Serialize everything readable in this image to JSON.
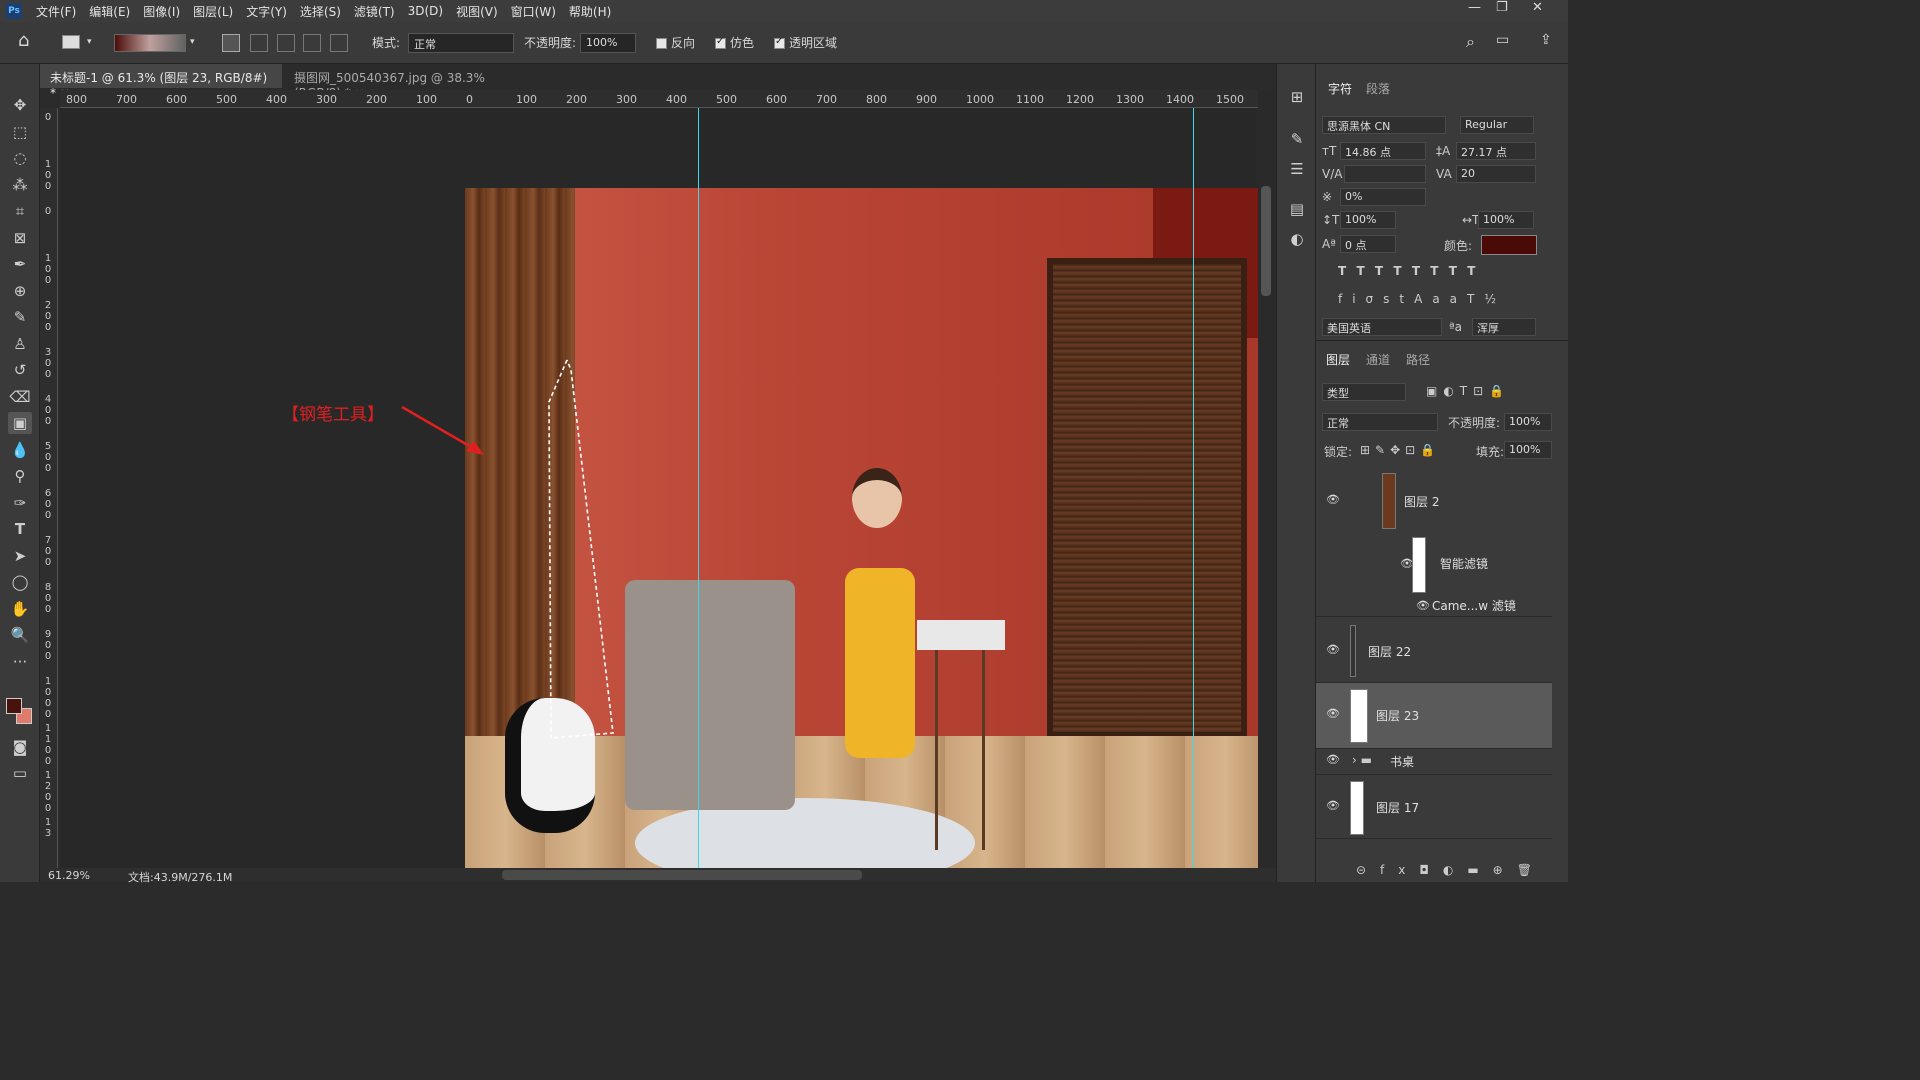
{
  "app": {
    "logo": "Ps"
  },
  "menu": [
    "文件(F)",
    "编辑(E)",
    "图像(I)",
    "图层(L)",
    "文字(Y)",
    "选择(S)",
    "滤镜(T)",
    "3D(D)",
    "视图(V)",
    "窗口(W)",
    "帮助(H)"
  ],
  "options": {
    "mode_label": "模式:",
    "mode_value": "正常",
    "opacity_label": "不透明度:",
    "opacity_value": "100%",
    "reverse_label": "反向",
    "dither_label": "仿色",
    "transparency_label": "透明区域"
  },
  "tabs": [
    {
      "label": "未标题-1 @ 61.3% (图层 23, RGB/8#) *",
      "close": "×"
    },
    {
      "label": "摄图网_500540367.jpg @ 38.3%(RGB/8) *",
      "close": "×"
    }
  ],
  "ruler_h": [
    "800",
    "700",
    "600",
    "500",
    "400",
    "300",
    "200",
    "100",
    "0",
    "100",
    "200",
    "300",
    "400",
    "500",
    "600",
    "700",
    "800",
    "900",
    "1000",
    "1100",
    "1200",
    "1300",
    "1400",
    "1500"
  ],
  "ruler_v": [
    "0",
    "1 0 0",
    "0",
    "1 0 0",
    "2 0 0",
    "3 0 0",
    "4 0 0",
    "5 0 0",
    "6 0 0",
    "7 0 0",
    "8 0 0",
    "9 0 0",
    "1 0 0 0",
    "1 1 0 0",
    "1 2 0 0",
    "1 3"
  ],
  "annotation": "【钢笔工具】",
  "status": {
    "zoom": "61.29%",
    "doc": "文档:43.9M/276.1M"
  },
  "character": {
    "tab1": "字符",
    "tab2": "段落",
    "font": "思源黑体 CN",
    "style": "Regular",
    "size": "14.86 点",
    "leading": "27.17 点",
    "kerning": "",
    "tracking": "20",
    "scale_pct": "0%",
    "vscale": "100%",
    "hscale": "100%",
    "baseline": "0 点",
    "color_label": "颜色:",
    "color": "#4a0a06",
    "language": "美国英语",
    "aa": "浑厚",
    "aa_icon": "ªa"
  },
  "layers": {
    "tab1": "图层",
    "tab2": "通道",
    "tab3": "路径",
    "filter": "类型",
    "blend": "正常",
    "opacity_label": "不透明度:",
    "opacity": "100%",
    "lock_label": "锁定:",
    "fill_label": "填充:",
    "fill": "100%",
    "items": [
      {
        "name": "图层 2"
      },
      {
        "name": "智能滤镜"
      },
      {
        "name": "Came...w 滤镜"
      },
      {
        "name": "图层 22"
      },
      {
        "name": "图层 23"
      },
      {
        "name": "书桌"
      },
      {
        "name": "图层 17"
      }
    ]
  },
  "colors": {
    "fg": "#4a120c",
    "bg": "#e07a6a",
    "accent": "#2d8cf0"
  }
}
